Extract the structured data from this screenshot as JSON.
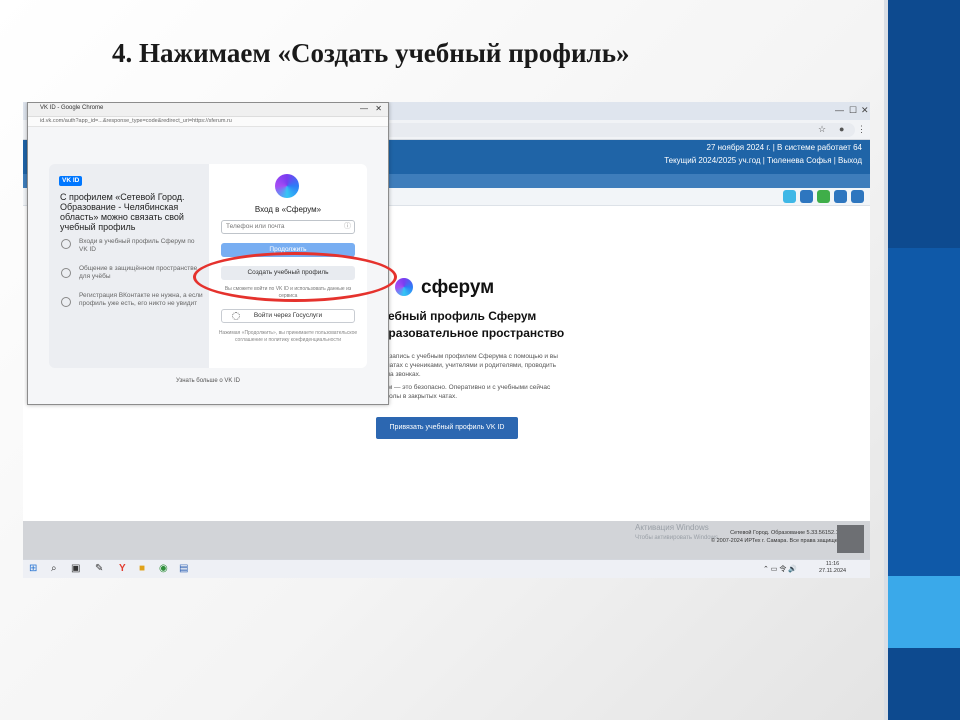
{
  "slide": {
    "title": "4. Нажимаем «Создать учебный профиль»"
  },
  "browser": {
    "header_line1": "27 ноября 2024 г. | В системе работает 64",
    "header_line2": "Текущий 2024/2025 уч.год | Тюленева Софья | Выход"
  },
  "popup": {
    "window_title": "VK ID - Google Chrome",
    "address": "id.vk.com/auth?app_id=...&response_type=code&redirect_uri=https://sferum.ru",
    "badge": "VK ID",
    "left_title": "С профилем «Сетевой Город. Образование - Челябинская область» можно связать свой учебный профиль",
    "features": [
      {
        "text": "Входи в учебный профиль Сферум по VK ID"
      },
      {
        "text": "Общение в защищённом пространстве для учёбы"
      },
      {
        "text": "Регистрация ВКонтакте не нужна, а если профиль уже есть, его никто не увидит"
      }
    ],
    "right_heading": "Вход в «Сферум»",
    "input_placeholder": "Телефон или почта",
    "continue_label": "Продолжить",
    "create_label": "Создать учебный профиль",
    "hint_text": "Вы сможете войти по VK ID и использовать данные из сервиса",
    "gosuslugi_label": "Войти через Госуслуги",
    "legal_text": "Нажимая «Продолжить», вы принимаете пользовательское соглашение и политику конфиденциальности",
    "more_link": "Узнать больше о VK ID"
  },
  "page": {
    "brand": "сферум",
    "heading1": "чебный профиль Сферум",
    "heading2": "бразовательное пространство",
    "text1": "то запись с учебным профилем Сферума с помощью и вы",
    "text2": "в чатах с учениками, учителями и родителями, проводить",
    "text3": "и на звонках.",
    "text4": "рум — это безопасно. Оперативно и с учебными сейчас",
    "text5": "школы в закрытых чатах.",
    "link_button": "Привязать учебный профиль VK ID"
  },
  "footer": {
    "activate_line1": "Активация Windows",
    "activate_line2": "Чтобы активировать Windows",
    "copyright_line1": "Сетевой Город. Образование 5.33.56152.173",
    "copyright_line2": "© 2007-2024 ИРТех г. Самара. Все права защищены"
  },
  "taskbar": {
    "tray": "⌃ ▭ 令 🔊",
    "time": "11:16",
    "date": "27.11.2024"
  },
  "colors": {
    "accent": "#1f64a7",
    "annotation": "#e5322d",
    "vk_blue": "#0077ff"
  }
}
